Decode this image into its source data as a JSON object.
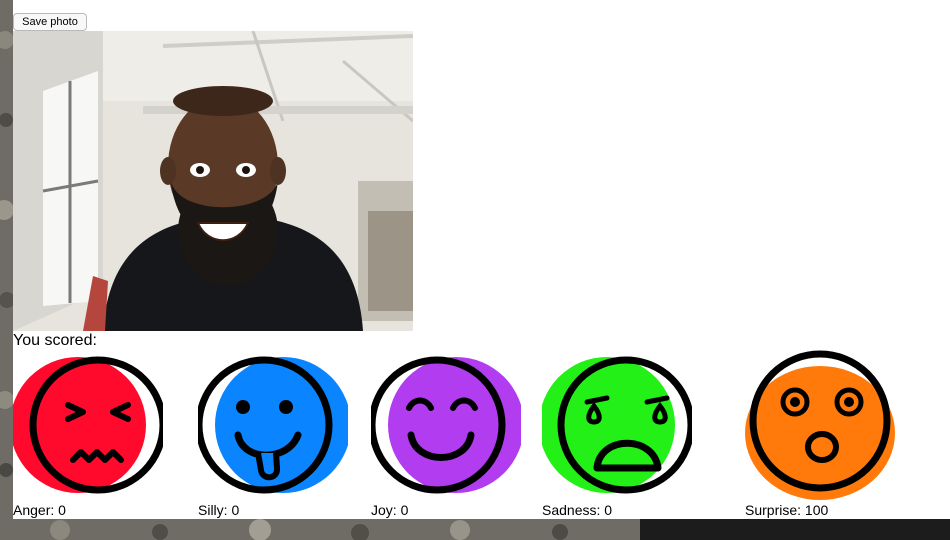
{
  "toolbar": {
    "save_label": "Save photo"
  },
  "photo": {
    "subject": "smiling bearded man in black shirt in office"
  },
  "results": {
    "heading": "You scored:",
    "emotions": [
      {
        "name": "Anger",
        "value": 0,
        "color": "#ff0a2c"
      },
      {
        "name": "Silly",
        "value": 0,
        "color": "#0a84ff"
      },
      {
        "name": "Joy",
        "value": 0,
        "color": "#b23cf0"
      },
      {
        "name": "Sadness",
        "value": 0,
        "color": "#22f016"
      },
      {
        "name": "Surprise",
        "value": 100,
        "color": "#ff7a0a"
      }
    ]
  }
}
